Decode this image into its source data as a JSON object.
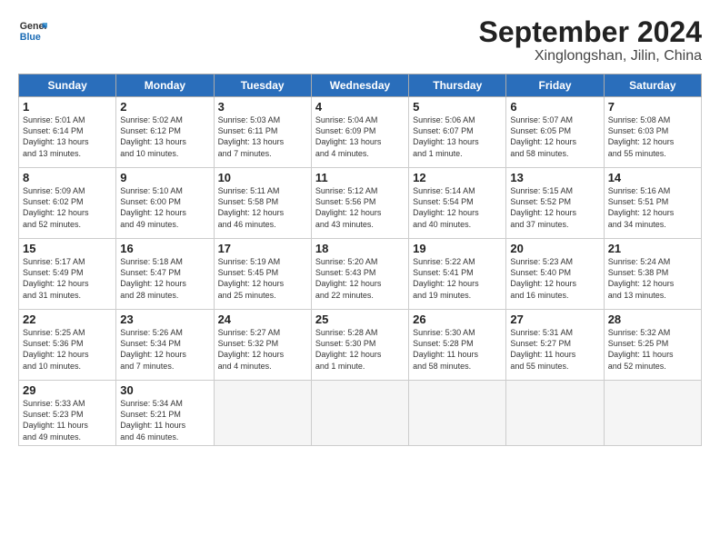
{
  "header": {
    "logo_line1": "General",
    "logo_line2": "Blue",
    "month": "September 2024",
    "location": "Xinglongshan, Jilin, China"
  },
  "days_of_week": [
    "Sunday",
    "Monday",
    "Tuesday",
    "Wednesday",
    "Thursday",
    "Friday",
    "Saturday"
  ],
  "weeks": [
    [
      {
        "num": "1",
        "lines": [
          "Sunrise: 5:01 AM",
          "Sunset: 6:14 PM",
          "Daylight: 13 hours",
          "and 13 minutes."
        ]
      },
      {
        "num": "2",
        "lines": [
          "Sunrise: 5:02 AM",
          "Sunset: 6:12 PM",
          "Daylight: 13 hours",
          "and 10 minutes."
        ]
      },
      {
        "num": "3",
        "lines": [
          "Sunrise: 5:03 AM",
          "Sunset: 6:11 PM",
          "Daylight: 13 hours",
          "and 7 minutes."
        ]
      },
      {
        "num": "4",
        "lines": [
          "Sunrise: 5:04 AM",
          "Sunset: 6:09 PM",
          "Daylight: 13 hours",
          "and 4 minutes."
        ]
      },
      {
        "num": "5",
        "lines": [
          "Sunrise: 5:06 AM",
          "Sunset: 6:07 PM",
          "Daylight: 13 hours",
          "and 1 minute."
        ]
      },
      {
        "num": "6",
        "lines": [
          "Sunrise: 5:07 AM",
          "Sunset: 6:05 PM",
          "Daylight: 12 hours",
          "and 58 minutes."
        ]
      },
      {
        "num": "7",
        "lines": [
          "Sunrise: 5:08 AM",
          "Sunset: 6:03 PM",
          "Daylight: 12 hours",
          "and 55 minutes."
        ]
      }
    ],
    [
      {
        "num": "8",
        "lines": [
          "Sunrise: 5:09 AM",
          "Sunset: 6:02 PM",
          "Daylight: 12 hours",
          "and 52 minutes."
        ]
      },
      {
        "num": "9",
        "lines": [
          "Sunrise: 5:10 AM",
          "Sunset: 6:00 PM",
          "Daylight: 12 hours",
          "and 49 minutes."
        ]
      },
      {
        "num": "10",
        "lines": [
          "Sunrise: 5:11 AM",
          "Sunset: 5:58 PM",
          "Daylight: 12 hours",
          "and 46 minutes."
        ]
      },
      {
        "num": "11",
        "lines": [
          "Sunrise: 5:12 AM",
          "Sunset: 5:56 PM",
          "Daylight: 12 hours",
          "and 43 minutes."
        ]
      },
      {
        "num": "12",
        "lines": [
          "Sunrise: 5:14 AM",
          "Sunset: 5:54 PM",
          "Daylight: 12 hours",
          "and 40 minutes."
        ]
      },
      {
        "num": "13",
        "lines": [
          "Sunrise: 5:15 AM",
          "Sunset: 5:52 PM",
          "Daylight: 12 hours",
          "and 37 minutes."
        ]
      },
      {
        "num": "14",
        "lines": [
          "Sunrise: 5:16 AM",
          "Sunset: 5:51 PM",
          "Daylight: 12 hours",
          "and 34 minutes."
        ]
      }
    ],
    [
      {
        "num": "15",
        "lines": [
          "Sunrise: 5:17 AM",
          "Sunset: 5:49 PM",
          "Daylight: 12 hours",
          "and 31 minutes."
        ]
      },
      {
        "num": "16",
        "lines": [
          "Sunrise: 5:18 AM",
          "Sunset: 5:47 PM",
          "Daylight: 12 hours",
          "and 28 minutes."
        ]
      },
      {
        "num": "17",
        "lines": [
          "Sunrise: 5:19 AM",
          "Sunset: 5:45 PM",
          "Daylight: 12 hours",
          "and 25 minutes."
        ]
      },
      {
        "num": "18",
        "lines": [
          "Sunrise: 5:20 AM",
          "Sunset: 5:43 PM",
          "Daylight: 12 hours",
          "and 22 minutes."
        ]
      },
      {
        "num": "19",
        "lines": [
          "Sunrise: 5:22 AM",
          "Sunset: 5:41 PM",
          "Daylight: 12 hours",
          "and 19 minutes."
        ]
      },
      {
        "num": "20",
        "lines": [
          "Sunrise: 5:23 AM",
          "Sunset: 5:40 PM",
          "Daylight: 12 hours",
          "and 16 minutes."
        ]
      },
      {
        "num": "21",
        "lines": [
          "Sunrise: 5:24 AM",
          "Sunset: 5:38 PM",
          "Daylight: 12 hours",
          "and 13 minutes."
        ]
      }
    ],
    [
      {
        "num": "22",
        "lines": [
          "Sunrise: 5:25 AM",
          "Sunset: 5:36 PM",
          "Daylight: 12 hours",
          "and 10 minutes."
        ]
      },
      {
        "num": "23",
        "lines": [
          "Sunrise: 5:26 AM",
          "Sunset: 5:34 PM",
          "Daylight: 12 hours",
          "and 7 minutes."
        ]
      },
      {
        "num": "24",
        "lines": [
          "Sunrise: 5:27 AM",
          "Sunset: 5:32 PM",
          "Daylight: 12 hours",
          "and 4 minutes."
        ]
      },
      {
        "num": "25",
        "lines": [
          "Sunrise: 5:28 AM",
          "Sunset: 5:30 PM",
          "Daylight: 12 hours",
          "and 1 minute."
        ]
      },
      {
        "num": "26",
        "lines": [
          "Sunrise: 5:30 AM",
          "Sunset: 5:28 PM",
          "Daylight: 11 hours",
          "and 58 minutes."
        ]
      },
      {
        "num": "27",
        "lines": [
          "Sunrise: 5:31 AM",
          "Sunset: 5:27 PM",
          "Daylight: 11 hours",
          "and 55 minutes."
        ]
      },
      {
        "num": "28",
        "lines": [
          "Sunrise: 5:32 AM",
          "Sunset: 5:25 PM",
          "Daylight: 11 hours",
          "and 52 minutes."
        ]
      }
    ],
    [
      {
        "num": "29",
        "lines": [
          "Sunrise: 5:33 AM",
          "Sunset: 5:23 PM",
          "Daylight: 11 hours",
          "and 49 minutes."
        ]
      },
      {
        "num": "30",
        "lines": [
          "Sunrise: 5:34 AM",
          "Sunset: 5:21 PM",
          "Daylight: 11 hours",
          "and 46 minutes."
        ]
      },
      null,
      null,
      null,
      null,
      null
    ]
  ]
}
